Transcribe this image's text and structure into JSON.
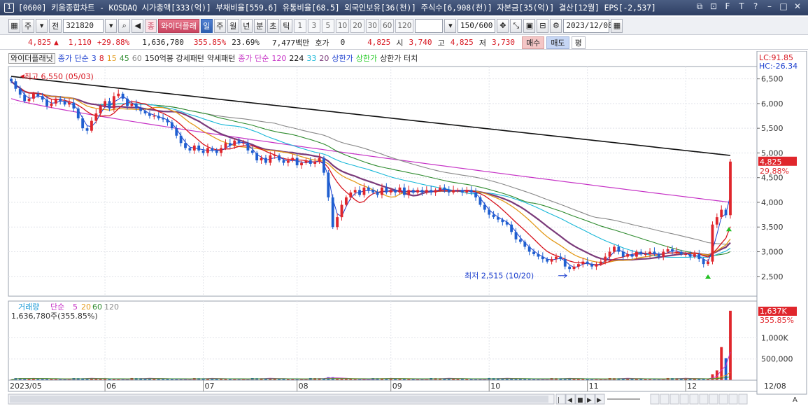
{
  "window": {
    "number": "1",
    "title": "[0600] 키움종합차트 - KOSDAQ 시가총액[333(억)] 부채비율[559.6] 유통비율[68.5] 외국인보유[36(천)] 주식수[6,908(천)] 자본금[35(억)] 결산[12월] EPS[-2,537]",
    "buttons": [
      "⧉",
      "⊡",
      "F",
      "T",
      "?",
      "–",
      "□",
      "✕"
    ]
  },
  "toolbar": {
    "market": "주",
    "prefix": "전",
    "code": "321820",
    "brand_chip": "종",
    "stock_name": "와이더플래",
    "periods": [
      "일",
      "주",
      "월",
      "년",
      "분",
      "초",
      "틱"
    ],
    "active_period": "일",
    "intervals": [
      "1",
      "3",
      "5",
      "10",
      "20",
      "30",
      "60",
      "120"
    ],
    "count": "150/600",
    "date": "2023/12/08"
  },
  "quote": {
    "price": "4,825",
    "change": "1,110",
    "change_pct": "+29.88%",
    "volume": "1,636,780",
    "volume_ratio": "355.85%",
    "turnover": "23.69%",
    "amount": "7,477백만",
    "hoga_label": "호가",
    "hoga_value": "0",
    "hoga_price": "4,825",
    "open_label": "시",
    "open": "3,740",
    "high_label": "고",
    "high": "4,825",
    "low_label": "저",
    "low": "3,730",
    "buy": "매수",
    "sell": "매도",
    "flat": "평"
  },
  "legend": {
    "chip": "와이더플래닛",
    "price_label": "종가 단순",
    "ma": [
      {
        "label": "3",
        "color": "#1c3fcf"
      },
      {
        "label": "8",
        "color": "#d7141e"
      },
      {
        "label": "15",
        "color": "#e39a1a"
      },
      {
        "label": "45",
        "color": "#2e8b2e"
      },
      {
        "label": "60",
        "color": "#888888"
      }
    ],
    "pattern1": "150억봉 강세패턴",
    "pattern2": "약세패턴",
    "price_label2": "종가 단순",
    "ma2": [
      {
        "label": "120",
        "color": "#c633c6"
      },
      {
        "label": "224",
        "color": "#111111"
      },
      {
        "label": "33",
        "color": "#19b8d8"
      },
      {
        "label": "20",
        "color": "#7a3a7a"
      }
    ],
    "upper_limit": "상한가",
    "upper_limit2": "상한가",
    "upper_touch": "상한가 터치"
  },
  "chart_data": {
    "type": "candlestick",
    "y_ticks": [
      "6,500",
      "6,000",
      "5,500",
      "5,000",
      "4,500",
      "4,000",
      "3,500",
      "3,000",
      "2,500"
    ],
    "ylim": [
      2100,
      6750
    ],
    "lc": "LC:91.85",
    "hc": "HC:-26.34",
    "high_annotation": "최고 6,550 (05/03)",
    "low_annotation": "최저 2,515 (10/20)",
    "price_badge": "4,825",
    "pct_badge": "29.88%",
    "x_labels": [
      "2023/05",
      "06",
      "07",
      "08",
      "09",
      "10",
      "11",
      "12",
      "12/08"
    ],
    "closes": [
      6450,
      6300,
      6180,
      6050,
      6100,
      6200,
      6150,
      6080,
      5950,
      6000,
      6100,
      6050,
      5980,
      6020,
      5900,
      5700,
      5500,
      5450,
      5650,
      5800,
      5950,
      6050,
      5900,
      6150,
      6200,
      6100,
      5950,
      6000,
      5900,
      5850,
      5800,
      5750,
      5750,
      5700,
      5680,
      5620,
      5500,
      5350,
      5200,
      5100,
      5050,
      5150,
      5050,
      5000,
      5100,
      5050,
      5000,
      5100,
      5200,
      5150,
      5250,
      5200,
      5200,
      5050,
      5000,
      4850,
      4900,
      4800,
      4950,
      4950,
      4850,
      4800,
      4850,
      4900,
      4750,
      4800,
      4850,
      4780,
      4820,
      4900,
      4600,
      4100,
      3500,
      3700,
      3950,
      4100,
      4200,
      4250,
      4150,
      4300,
      4250,
      4200,
      4150,
      4300,
      4200,
      4250,
      4200,
      4300,
      4150,
      4250,
      4200,
      4250,
      4200,
      4250,
      4200,
      4250,
      4300,
      4250,
      4200,
      4250,
      4250,
      4200,
      4250,
      4200,
      4100,
      3950,
      3850,
      3750,
      3700,
      3650,
      3600,
      3550,
      3400,
      3250,
      3200,
      3100,
      3000,
      2950,
      2900,
      2850,
      2800,
      2850,
      2900,
      2850,
      2700,
      2650,
      2700,
      2750,
      2800,
      2750,
      2700,
      2750,
      2800,
      2900,
      3000,
      3100,
      3000,
      2900,
      2950,
      2900,
      3000,
      2950,
      2950,
      3000,
      2950,
      2900,
      3000,
      3050,
      3000,
      3000,
      2950,
      2950,
      2900,
      2950,
      2850,
      2750,
      2800,
      3550,
      3700,
      3850,
      3740,
      4825
    ],
    "vol_ticks": [
      "1,000K",
      "500,000"
    ],
    "vol_ylim": [
      0,
      1700000
    ],
    "vol_label": "거래량",
    "vol_ma_label": "단순",
    "vol_ma": [
      {
        "label": "5",
        "color": "#c633c6"
      },
      {
        "label": "20",
        "color": "#e39a1a"
      },
      {
        "label": "60",
        "color": "#2e8b2e"
      },
      {
        "label": "120",
        "color": "#888888"
      }
    ],
    "vol_value": "1,636,780주(355.85%)",
    "vol_badge": "1,637K",
    "vol_pct_badge": "355.85%"
  }
}
